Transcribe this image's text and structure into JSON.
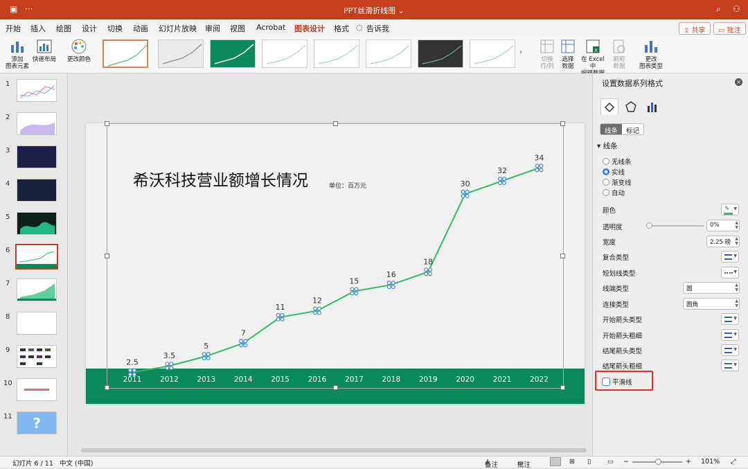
{
  "titlebar": {
    "title": "PPT丝滑折线图",
    "menu_glyph": "···"
  },
  "ribbon_tabs": [
    "开始",
    "插入",
    "绘图",
    "设计",
    "切换",
    "动画",
    "幻灯片放映",
    "审阅",
    "视图",
    "Acrobat",
    "图表设计",
    "格式",
    "告诉我"
  ],
  "active_tab": "图表设计",
  "top_buttons": {
    "share": "共享",
    "comment": "批注"
  },
  "ribbon_buttons": {
    "add_element": [
      "添加",
      "图表元素"
    ],
    "quick_layout": "快速布局",
    "change_colors": "更改颜色",
    "switch_rowcol": [
      "切换",
      "行/列"
    ],
    "select_data": [
      "选择",
      "数据"
    ],
    "edit_excel": [
      "在 Excel 中",
      "编辑数据"
    ],
    "refresh_data": [
      "刷新",
      "数据"
    ],
    "change_type": [
      "更改",
      "图表类型"
    ]
  },
  "slides": {
    "numbers": [
      "1",
      "2",
      "3",
      "4",
      "5",
      "6",
      "7",
      "8",
      "9",
      "10",
      "11"
    ],
    "selected_index": 5
  },
  "slide": {
    "title": "希沃科技营业额增长情况",
    "unit": "单位：百万元"
  },
  "chart_data": {
    "type": "line",
    "title": "希沃科技营业额增长情况",
    "categories": [
      "2011",
      "2012",
      "2013",
      "2014",
      "2015",
      "2016",
      "2017",
      "2018",
      "2019",
      "2020",
      "2021",
      "2022"
    ],
    "values": [
      2.5,
      3.5,
      5,
      7,
      11,
      12,
      15,
      16,
      18,
      30,
      32,
      34
    ],
    "data_labels": [
      "2.5",
      "3.5",
      "5",
      "7",
      "11",
      "12",
      "15",
      "16",
      "18",
      "30",
      "32",
      "34"
    ],
    "ylim": [
      0,
      37
    ],
    "line_color": "#2cbd62",
    "band_color": "#0a8a5a",
    "grid": false,
    "legend": "none"
  },
  "format_pane": {
    "title": "设置数据系列格式",
    "tabs": [
      "线条",
      "标记"
    ],
    "active_tab": "线条",
    "section": "线条",
    "line_options": [
      "无线条",
      "实线",
      "渐变线",
      "自动"
    ],
    "selected_option": "实线",
    "props": {
      "color": "颜色",
      "transparency": "透明度",
      "transparency_value": "0%",
      "width": "宽度",
      "width_value": "2.25 磅",
      "compound": "复合类型",
      "dash": "短划线类型",
      "cap": "线端类型",
      "cap_value": "圆",
      "join": "连接类型",
      "join_value": "圆角",
      "begin_arrow_type": "开始箭头类型",
      "begin_arrow_size": "开始箭头粗细",
      "end_arrow_type": "结尾箭头类型",
      "end_arrow_size": "结尾箭头粗细"
    },
    "smooth_line": "平滑线",
    "smooth_checked": false
  },
  "statusbar": {
    "slide_info": "幻灯片 6 / 11",
    "language": "中文 (中国)",
    "notes": "备注",
    "comments": "批注",
    "zoom": "101%"
  },
  "colors": {
    "accent": "#c43e1c",
    "highlight": "#e8282e",
    "check_blue": "#2f7cf6"
  }
}
